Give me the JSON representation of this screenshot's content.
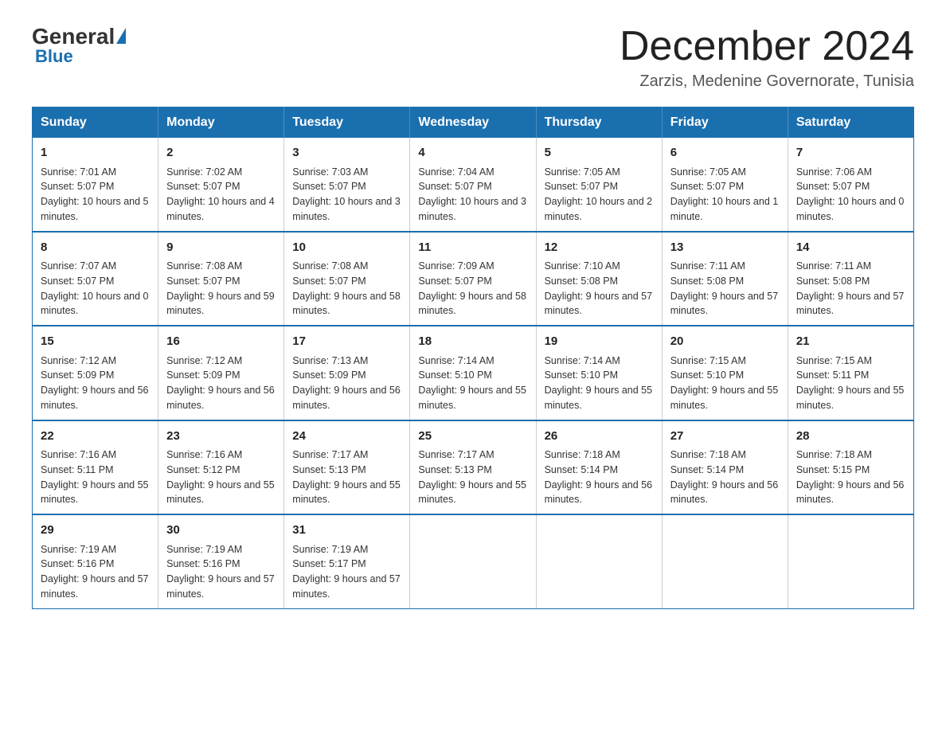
{
  "header": {
    "logo_general": "General",
    "logo_blue": "Blue",
    "month_title": "December 2024",
    "location": "Zarzis, Medenine Governorate, Tunisia"
  },
  "days_of_week": [
    "Sunday",
    "Monday",
    "Tuesday",
    "Wednesday",
    "Thursday",
    "Friday",
    "Saturday"
  ],
  "weeks": [
    [
      {
        "day": "1",
        "sunrise": "7:01 AM",
        "sunset": "5:07 PM",
        "daylight": "10 hours and 5 minutes."
      },
      {
        "day": "2",
        "sunrise": "7:02 AM",
        "sunset": "5:07 PM",
        "daylight": "10 hours and 4 minutes."
      },
      {
        "day": "3",
        "sunrise": "7:03 AM",
        "sunset": "5:07 PM",
        "daylight": "10 hours and 3 minutes."
      },
      {
        "day": "4",
        "sunrise": "7:04 AM",
        "sunset": "5:07 PM",
        "daylight": "10 hours and 3 minutes."
      },
      {
        "day": "5",
        "sunrise": "7:05 AM",
        "sunset": "5:07 PM",
        "daylight": "10 hours and 2 minutes."
      },
      {
        "day": "6",
        "sunrise": "7:05 AM",
        "sunset": "5:07 PM",
        "daylight": "10 hours and 1 minute."
      },
      {
        "day": "7",
        "sunrise": "7:06 AM",
        "sunset": "5:07 PM",
        "daylight": "10 hours and 0 minutes."
      }
    ],
    [
      {
        "day": "8",
        "sunrise": "7:07 AM",
        "sunset": "5:07 PM",
        "daylight": "10 hours and 0 minutes."
      },
      {
        "day": "9",
        "sunrise": "7:08 AM",
        "sunset": "5:07 PM",
        "daylight": "9 hours and 59 minutes."
      },
      {
        "day": "10",
        "sunrise": "7:08 AM",
        "sunset": "5:07 PM",
        "daylight": "9 hours and 58 minutes."
      },
      {
        "day": "11",
        "sunrise": "7:09 AM",
        "sunset": "5:07 PM",
        "daylight": "9 hours and 58 minutes."
      },
      {
        "day": "12",
        "sunrise": "7:10 AM",
        "sunset": "5:08 PM",
        "daylight": "9 hours and 57 minutes."
      },
      {
        "day": "13",
        "sunrise": "7:11 AM",
        "sunset": "5:08 PM",
        "daylight": "9 hours and 57 minutes."
      },
      {
        "day": "14",
        "sunrise": "7:11 AM",
        "sunset": "5:08 PM",
        "daylight": "9 hours and 57 minutes."
      }
    ],
    [
      {
        "day": "15",
        "sunrise": "7:12 AM",
        "sunset": "5:09 PM",
        "daylight": "9 hours and 56 minutes."
      },
      {
        "day": "16",
        "sunrise": "7:12 AM",
        "sunset": "5:09 PM",
        "daylight": "9 hours and 56 minutes."
      },
      {
        "day": "17",
        "sunrise": "7:13 AM",
        "sunset": "5:09 PM",
        "daylight": "9 hours and 56 minutes."
      },
      {
        "day": "18",
        "sunrise": "7:14 AM",
        "sunset": "5:10 PM",
        "daylight": "9 hours and 55 minutes."
      },
      {
        "day": "19",
        "sunrise": "7:14 AM",
        "sunset": "5:10 PM",
        "daylight": "9 hours and 55 minutes."
      },
      {
        "day": "20",
        "sunrise": "7:15 AM",
        "sunset": "5:10 PM",
        "daylight": "9 hours and 55 minutes."
      },
      {
        "day": "21",
        "sunrise": "7:15 AM",
        "sunset": "5:11 PM",
        "daylight": "9 hours and 55 minutes."
      }
    ],
    [
      {
        "day": "22",
        "sunrise": "7:16 AM",
        "sunset": "5:11 PM",
        "daylight": "9 hours and 55 minutes."
      },
      {
        "day": "23",
        "sunrise": "7:16 AM",
        "sunset": "5:12 PM",
        "daylight": "9 hours and 55 minutes."
      },
      {
        "day": "24",
        "sunrise": "7:17 AM",
        "sunset": "5:13 PM",
        "daylight": "9 hours and 55 minutes."
      },
      {
        "day": "25",
        "sunrise": "7:17 AM",
        "sunset": "5:13 PM",
        "daylight": "9 hours and 55 minutes."
      },
      {
        "day": "26",
        "sunrise": "7:18 AM",
        "sunset": "5:14 PM",
        "daylight": "9 hours and 56 minutes."
      },
      {
        "day": "27",
        "sunrise": "7:18 AM",
        "sunset": "5:14 PM",
        "daylight": "9 hours and 56 minutes."
      },
      {
        "day": "28",
        "sunrise": "7:18 AM",
        "sunset": "5:15 PM",
        "daylight": "9 hours and 56 minutes."
      }
    ],
    [
      {
        "day": "29",
        "sunrise": "7:19 AM",
        "sunset": "5:16 PM",
        "daylight": "9 hours and 57 minutes."
      },
      {
        "day": "30",
        "sunrise": "7:19 AM",
        "sunset": "5:16 PM",
        "daylight": "9 hours and 57 minutes."
      },
      {
        "day": "31",
        "sunrise": "7:19 AM",
        "sunset": "5:17 PM",
        "daylight": "9 hours and 57 minutes."
      },
      null,
      null,
      null,
      null
    ]
  ],
  "labels": {
    "sunrise_prefix": "Sunrise: ",
    "sunset_prefix": "Sunset: ",
    "daylight_prefix": "Daylight: "
  }
}
